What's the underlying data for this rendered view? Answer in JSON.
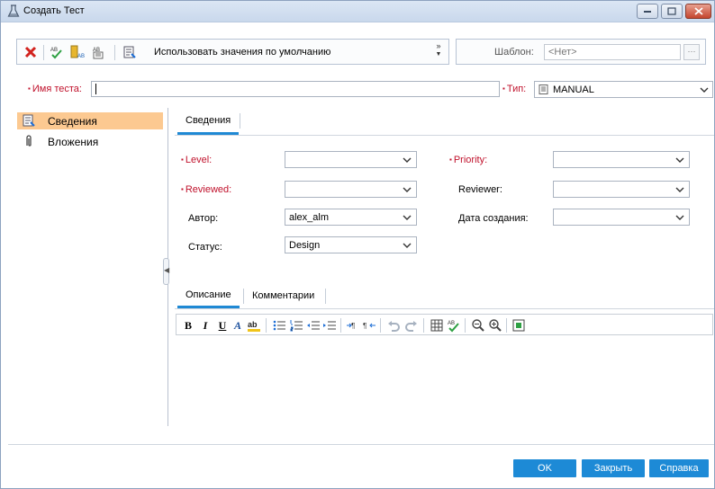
{
  "window": {
    "title": "Создать Тест"
  },
  "toolbar": {
    "use_defaults_label": "Использовать значения по умолчанию",
    "more_label": "»"
  },
  "template": {
    "label": "Шаблон:",
    "value": "<Нет>",
    "browse_label": "···"
  },
  "test_name": {
    "label": "Имя теста:",
    "value": ""
  },
  "type": {
    "label": "Тип:",
    "value": "MANUAL"
  },
  "sidebar": {
    "items": [
      {
        "label": "Сведения",
        "icon": "details-icon",
        "active": true
      },
      {
        "label": "Вложения",
        "icon": "paperclip-icon",
        "active": false
      }
    ]
  },
  "tabs": {
    "main": [
      {
        "label": "Сведения"
      }
    ],
    "description": [
      {
        "label": "Описание"
      },
      {
        "label": "Комментарии"
      }
    ]
  },
  "fields": {
    "level": {
      "label": "Level:",
      "value": "",
      "required": true
    },
    "priority": {
      "label": "Priority:",
      "value": "",
      "required": true
    },
    "reviewed": {
      "label": "Reviewed:",
      "value": "",
      "required": true
    },
    "reviewer": {
      "label": "Reviewer:",
      "value": ""
    },
    "author": {
      "label": "Автор:",
      "value": "alex_alm"
    },
    "created": {
      "label": "Дата создания:",
      "value": ""
    },
    "status": {
      "label": "Статус:",
      "value": "Design"
    }
  },
  "buttons": {
    "ok": "OK",
    "close": "Закрыть",
    "help": "Справка"
  },
  "colors": {
    "accent": "#1d8ad6",
    "required": "#c0112b",
    "active_sidebar": "#fcc991"
  }
}
